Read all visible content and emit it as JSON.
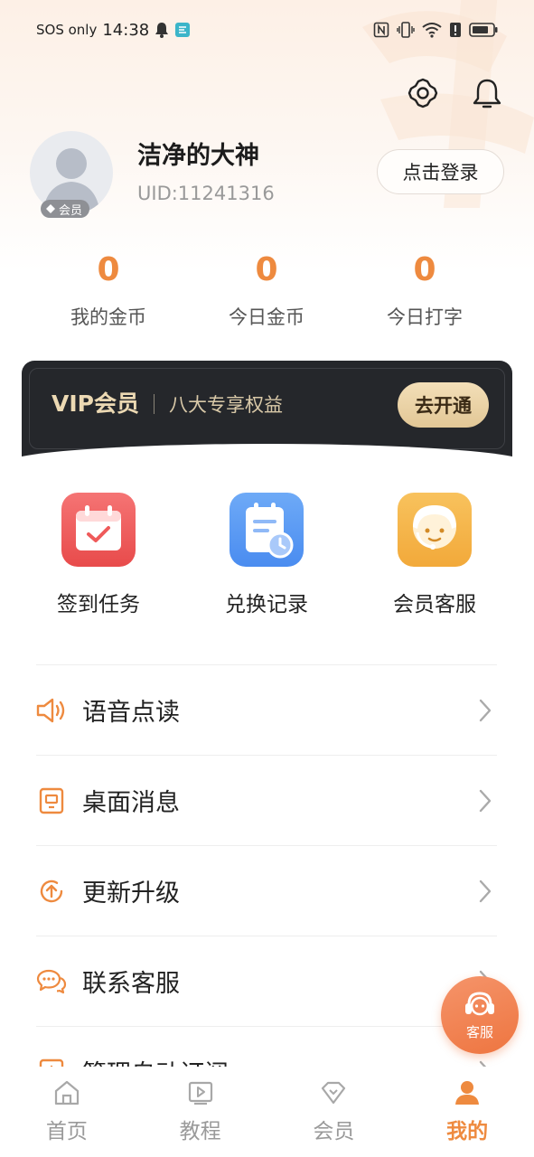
{
  "status_bar": {
    "carrier": "SOS only",
    "time": "14:38",
    "icons": [
      "bell-icon",
      "app-icon",
      "nfc-icon",
      "vibrate-icon",
      "wifi-icon",
      "alert-icon",
      "battery-icon"
    ]
  },
  "header": {
    "icons": [
      "settings-icon",
      "notification-bell-icon"
    ]
  },
  "profile": {
    "name": "洁净的大神",
    "uid": "UID:11241316",
    "member_tag": "会员",
    "login_button": "点击登录"
  },
  "stats": [
    {
      "value": "0",
      "label": "我的金币"
    },
    {
      "value": "0",
      "label": "今日金币"
    },
    {
      "value": "0",
      "label": "今日打字"
    }
  ],
  "vip": {
    "title": "VIP会员",
    "subtitle": "八大专享权益",
    "button": "去开通"
  },
  "quick_actions": [
    {
      "label": "签到任务",
      "icon": "calendar-check-icon",
      "color": "#ef5a5a"
    },
    {
      "label": "兑换记录",
      "icon": "record-clock-icon",
      "color": "#5b9cf5"
    },
    {
      "label": "会员客服",
      "icon": "support-agent-icon",
      "color": "#f5b54a"
    }
  ],
  "menu": [
    {
      "label": "语音点读",
      "icon": "speaker-icon"
    },
    {
      "label": "桌面消息",
      "icon": "message-box-icon"
    },
    {
      "label": "更新升级",
      "icon": "update-icon"
    },
    {
      "label": "联系客服",
      "icon": "chat-bubbles-icon"
    },
    {
      "label": "管理自动订阅",
      "icon": "plus-box-icon"
    }
  ],
  "fab": {
    "label": "客服"
  },
  "tabbar": [
    {
      "label": "首页",
      "icon": "home-icon",
      "active": false
    },
    {
      "label": "教程",
      "icon": "play-book-icon",
      "active": false
    },
    {
      "label": "会员",
      "icon": "diamond-heart-icon",
      "active": false
    },
    {
      "label": "我的",
      "icon": "user-icon",
      "active": true
    }
  ],
  "colors": {
    "accent": "#ee8a3f",
    "vip_bg": "#25272b",
    "vip_gold": "#ecd9b3"
  }
}
